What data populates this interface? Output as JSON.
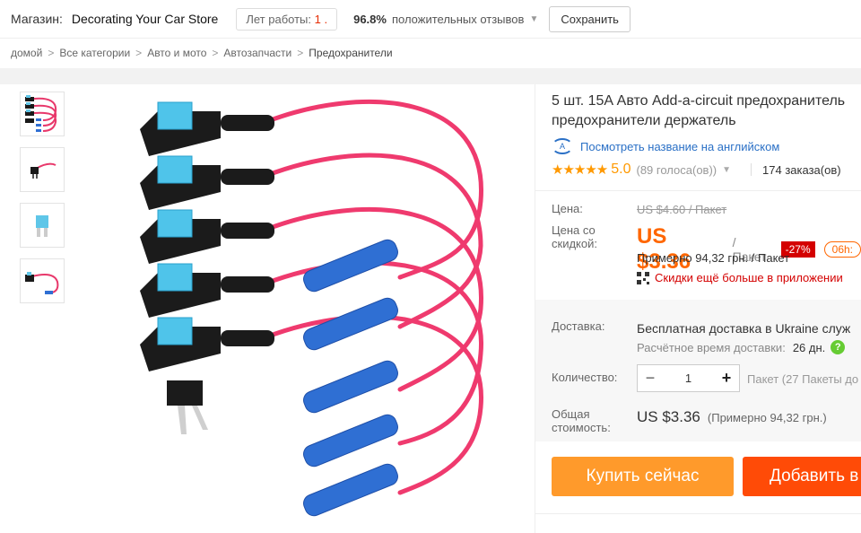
{
  "store": {
    "label": "Магазин:",
    "name": "Decorating Your Car Store",
    "years_label": "Лет работы:",
    "years_value": "1 .",
    "feedback_pct": "96.8%",
    "feedback_label": "положительных отзывов",
    "save_label": "Сохранить"
  },
  "breadcrumb": [
    "домой",
    "Все категории",
    "Авто и мото",
    "Автозапчасти",
    "Предохранители"
  ],
  "breadcrumb_sep": ">",
  "gallery": {
    "thumbnails": [
      "fuse-taps-set",
      "single-fuse-tap",
      "mini-fuse",
      "fuse-tap-with-connector"
    ]
  },
  "product": {
    "title_line1": "5 шт. 15A Авто Add-a-circuit предохранитель",
    "title_line2": "предохранители держатель",
    "translate_icon": "А",
    "translate_link": "Посмотреть название на английском",
    "stars": "★★★★★",
    "rating": "5.0",
    "votes": "(89 голоса(ов))",
    "orders": "174 заказа(ов)"
  },
  "pricing": {
    "price_label": "Цена:",
    "old_price": "US $4.60 / Пакет",
    "discount_label_1": "Цена со",
    "discount_label_2": "скидкой:",
    "new_price": "US $3.36",
    "unit": "/ Пакет",
    "discount": "-27%",
    "time_left": "06h:",
    "approx": "Примерно 94,32 грн. / Пакет",
    "app_offer": "Скидки ещё больше в приложении"
  },
  "shipping": {
    "label": "Доставка:",
    "value": "Бесплатная доставка в Ukraine служ",
    "time_label": "Расчётное время доставки:",
    "time_value": "26 дн.",
    "help": "?"
  },
  "quantity": {
    "label": "Количество:",
    "minus": "−",
    "value": "1",
    "plus": "+",
    "unit_note": "Пакет (27 Пакеты до"
  },
  "total": {
    "label_1": "Общая",
    "label_2": "стоимость:",
    "value": "US $3.36",
    "approx": "(Примерно 94,32 грн.)"
  },
  "actions": {
    "buy_now": "Купить сейчас",
    "add_to_cart": "Добавить в"
  },
  "colors": {
    "accent_orange": "#ff9a2b",
    "cart_orange": "#ff4b07",
    "price": "#ff6600",
    "discount_red": "#d40000",
    "link_blue": "#2a70c6",
    "star": "#ff9900"
  }
}
